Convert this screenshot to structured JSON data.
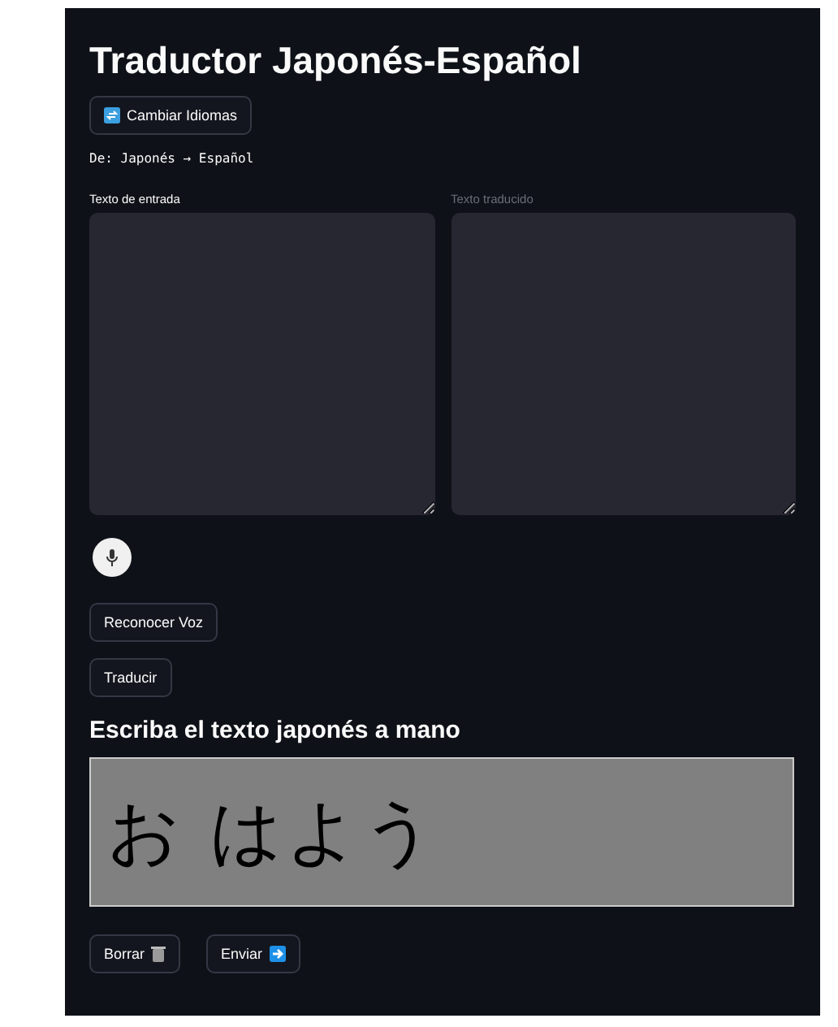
{
  "title": "Traductor Japonés-Español",
  "swap_button": {
    "label": "Cambiar Idiomas"
  },
  "direction": "De: Japonés → Español",
  "text_areas": [
    {
      "label": "Texto de entrada",
      "disabled": false
    },
    {
      "label": "Texto traducido",
      "disabled": true
    }
  ],
  "buttons": [
    {
      "label": "Reconocer Voz"
    },
    {
      "label": "Traducir"
    }
  ],
  "handwriting": {
    "heading": "Escriba el texto japonés a mano",
    "strokes_text": "お はよう"
  },
  "canvas_buttons": [
    {
      "label": "Borrar"
    },
    {
      "label": "Enviar"
    }
  ]
}
